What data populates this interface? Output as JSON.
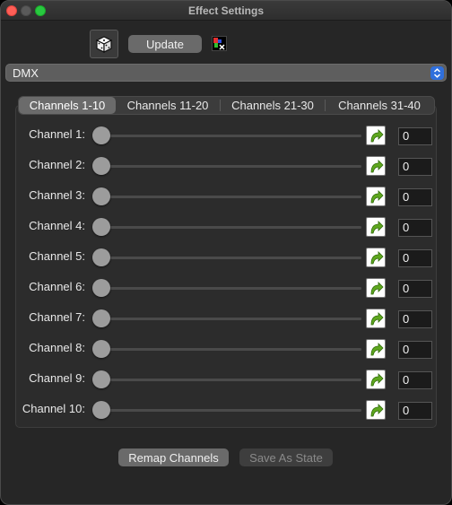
{
  "window": {
    "title": "Effect Settings"
  },
  "toolbar": {
    "update_label": "Update",
    "dice_icon": "dice-icon",
    "fx_icon": "fx-icon"
  },
  "effect_select": {
    "value": "DMX",
    "accent": "#2f6fdc"
  },
  "tabs": [
    {
      "label": "Channels 1-10",
      "active": true
    },
    {
      "label": "Channels 11-20",
      "active": false
    },
    {
      "label": "Channels 21-30",
      "active": false
    },
    {
      "label": "Channels 31-40",
      "active": false
    }
  ],
  "channels": [
    {
      "label": "Channel 1:",
      "value": "0",
      "level": 0
    },
    {
      "label": "Channel 2:",
      "value": "0",
      "level": 0
    },
    {
      "label": "Channel 3:",
      "value": "0",
      "level": 0
    },
    {
      "label": "Channel 4:",
      "value": "0",
      "level": 0
    },
    {
      "label": "Channel 5:",
      "value": "0",
      "level": 0
    },
    {
      "label": "Channel 6:",
      "value": "0",
      "level": 0
    },
    {
      "label": "Channel 7:",
      "value": "0",
      "level": 0
    },
    {
      "label": "Channel 8:",
      "value": "0",
      "level": 0
    },
    {
      "label": "Channel 9:",
      "value": "0",
      "level": 0
    },
    {
      "label": "Channel 10:",
      "value": "0",
      "level": 0
    }
  ],
  "footer": {
    "remap_label": "Remap Channels",
    "save_label": "Save As State"
  }
}
